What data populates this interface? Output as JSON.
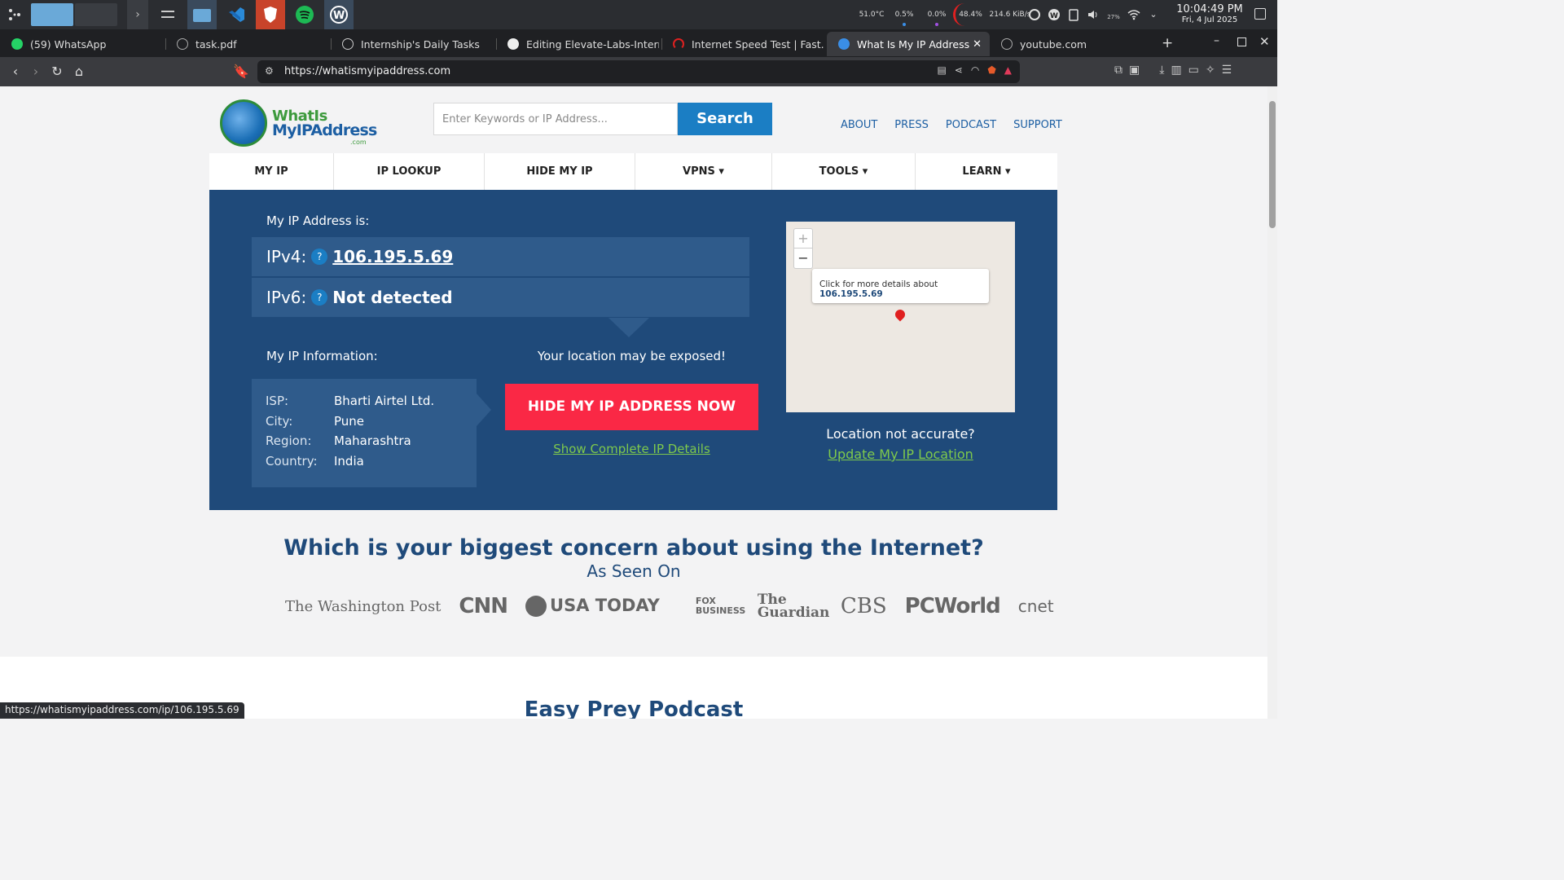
{
  "taskbar": {
    "stats": [
      "51.0°C",
      "0.5%",
      "0.0%",
      "48.4%",
      "214.6 KiB/s"
    ],
    "battery": "27%",
    "clock_time": "10:04:49 PM",
    "clock_date": "Fri, 4 Jul 2025"
  },
  "tabs": [
    {
      "label": "(59) WhatsApp",
      "active": false,
      "color": "#25d366"
    },
    {
      "label": "task.pdf",
      "active": false,
      "color": "#aaaaaa"
    },
    {
      "label": "Internship's Daily Tasks",
      "active": false,
      "color": "#cccccc"
    },
    {
      "label": "Editing Elevate-Labs-Internshi",
      "active": false,
      "color": "#eeeeee"
    },
    {
      "label": "Internet Speed Test | Fast.com",
      "active": false,
      "color": "#e02020"
    },
    {
      "label": "What Is My IP Address - Se",
      "active": true,
      "color": "#3a8ee6"
    },
    {
      "label": "youtube.com",
      "active": false,
      "color": "#aaaaaa"
    }
  ],
  "toolbar": {
    "url": "https://whatismyipaddress.com"
  },
  "site": {
    "logo_line1": "WhatIs",
    "logo_line2": "MyIPAddress",
    "logo_line3": ".com",
    "search_placeholder": "Enter Keywords or IP Address...",
    "search_button": "Search",
    "top_links": [
      "ABOUT",
      "PRESS",
      "PODCAST",
      "SUPPORT"
    ],
    "nav": [
      "MY IP",
      "IP LOOKUP",
      "HIDE MY IP",
      "VPNS ▾",
      "TOOLS ▾",
      "LEARN ▾"
    ]
  },
  "ip": {
    "heading": "My IP Address is:",
    "ipv4_label": "IPv4:",
    "ipv4": "106.195.5.69",
    "ipv6_label": "IPv6:",
    "ipv6": "Not detected",
    "qmark": "?"
  },
  "info": {
    "heading": "My IP Information:",
    "isp_k": "ISP:",
    "isp_v": "Bharti Airtel Ltd.",
    "city_k": "City:",
    "city_v": "Pune",
    "region_k": "Region:",
    "region_v": "Maharashtra",
    "country_k": "Country:",
    "country_v": "India"
  },
  "cta": {
    "warning": "Your location may be exposed!",
    "button": "HIDE MY IP ADDRESS NOW",
    "link": "Show Complete IP Details"
  },
  "map": {
    "zoom_in": "+",
    "zoom_out": "−",
    "popup_text": "Click for more details about",
    "popup_ip": "106.195.5.69",
    "loc_question": "Location not accurate?",
    "loc_link": "Update My IP Location"
  },
  "concern": "Which is your biggest concern about using the Internet?",
  "seen_on": "As Seen On",
  "press_logos": [
    "The Washington Post",
    "CNN",
    "USA TODAY",
    "FOX BUSINESS",
    "The Guardian",
    "CBS",
    "PCWorld",
    "cnet"
  ],
  "podcast_title": "Easy Prey Podcast",
  "status_url": "https://whatismyipaddress.com/ip/106.195.5.69"
}
